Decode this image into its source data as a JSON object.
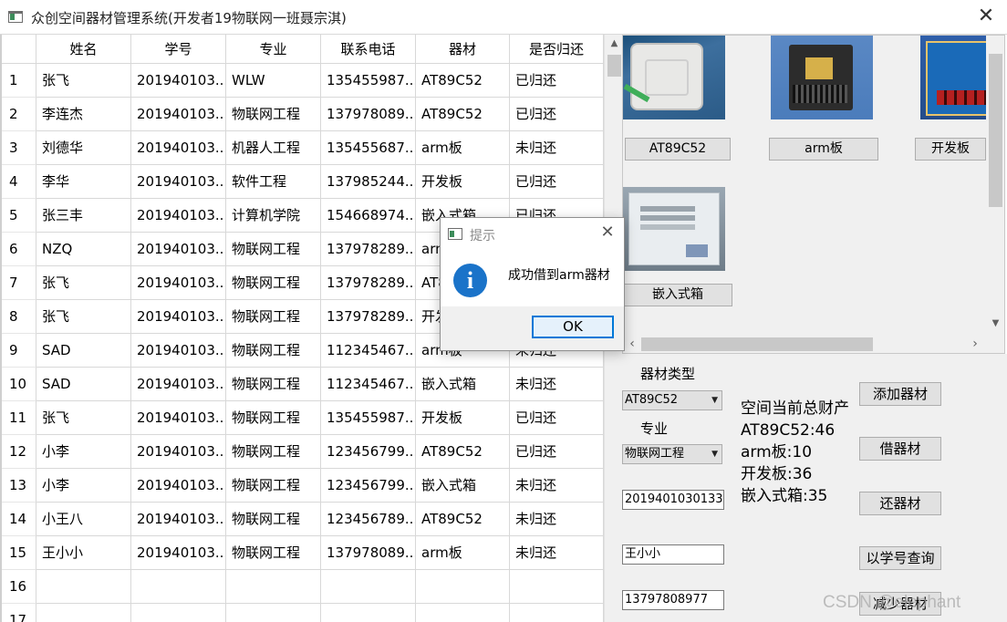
{
  "window": {
    "title": "众创空间器材管理系统(开发者19物联网一班聂宗淇)",
    "close_glyph": "✕"
  },
  "table": {
    "headers": [
      "姓名",
      "学号",
      "专业",
      "联系电话",
      "器材",
      "是否归还"
    ],
    "row_numbers": [
      "1",
      "2",
      "3",
      "4",
      "5",
      "6",
      "7",
      "8",
      "9",
      "10",
      "11",
      "12",
      "13",
      "14",
      "15",
      "16",
      "17"
    ],
    "rows": [
      [
        "张飞",
        "201940103...",
        "WLW",
        "135455987...",
        "AT89C52",
        "已归还"
      ],
      [
        "李连杰",
        "201940103...",
        "物联网工程",
        "137978089...",
        "AT89C52",
        "已归还"
      ],
      [
        "刘德华",
        "201940103...",
        "机器人工程",
        "135455687...",
        "arm板",
        "未归还"
      ],
      [
        "李华",
        "201940103...",
        "软件工程",
        "137985244...",
        "开发板",
        "已归还"
      ],
      [
        "张三丰",
        "201940103...",
        "计算机学院",
        "154668974...",
        "嵌入式箱",
        "已归还"
      ],
      [
        "NZQ",
        "201940103...",
        "物联网工程",
        "137978289...",
        "arm板",
        ""
      ],
      [
        "张飞",
        "201940103...",
        "物联网工程",
        "137978289...",
        "AT89C52",
        ""
      ],
      [
        "张飞",
        "201940103...",
        "物联网工程",
        "137978289...",
        "开发板",
        ""
      ],
      [
        "SAD",
        "201940103...",
        "物联网工程",
        "112345467...",
        "arm板",
        "未归还"
      ],
      [
        "SAD",
        "201940103...",
        "物联网工程",
        "112345467...",
        "嵌入式箱",
        "未归还"
      ],
      [
        "张飞",
        "201940103...",
        "物联网工程",
        "135455987...",
        "开发板",
        "已归还"
      ],
      [
        "小李",
        "201940103...",
        "物联网工程",
        "123456799...",
        "AT89C52",
        "已归还"
      ],
      [
        "小李",
        "201940103...",
        "物联网工程",
        "123456799...",
        "嵌入式箱",
        "未归还"
      ],
      [
        "小王八",
        "201940103...",
        "物联网工程",
        "123456789...",
        "AT89C52",
        "未归还"
      ],
      [
        "王小小",
        "201940103...",
        "物联网工程",
        "137978089...",
        "arm板",
        "未归还"
      ],
      [
        "",
        "",
        "",
        "",
        "",
        ""
      ],
      [
        "",
        "",
        "",
        "",
        "",
        ""
      ]
    ]
  },
  "gallery": {
    "items": [
      {
        "label": "AT89C52"
      },
      {
        "label": "arm板"
      },
      {
        "label": "开发板"
      },
      {
        "label": "嵌入式箱"
      }
    ]
  },
  "controls": {
    "equipment_type_label": "器材类型",
    "equipment_type_value": "AT89C52",
    "major_label": "专业",
    "major_value": "物联网工程",
    "student_id_value": "2019401030133",
    "name_value": "王小小",
    "phone_value": "13797808977",
    "assets_title": "空间当前总财产",
    "assets": [
      "AT89C52:46",
      "arm板:10",
      "开发板:36",
      "嵌入式箱:35"
    ],
    "buttons": {
      "add": "添加器材",
      "borrow": "借器材",
      "return": "还器材",
      "query": "以学号查询",
      "reduce": "减少器材"
    }
  },
  "modal": {
    "title": "提示",
    "message": "成功借到arm器材",
    "ok_label": "OK",
    "close_glyph": "✕",
    "info_glyph": "i"
  },
  "watermark": "CSDN @elephant",
  "scroll_glyphs": {
    "up": "▲",
    "down": "▼",
    "left": "‹",
    "right": "›",
    "caret": "▼"
  }
}
